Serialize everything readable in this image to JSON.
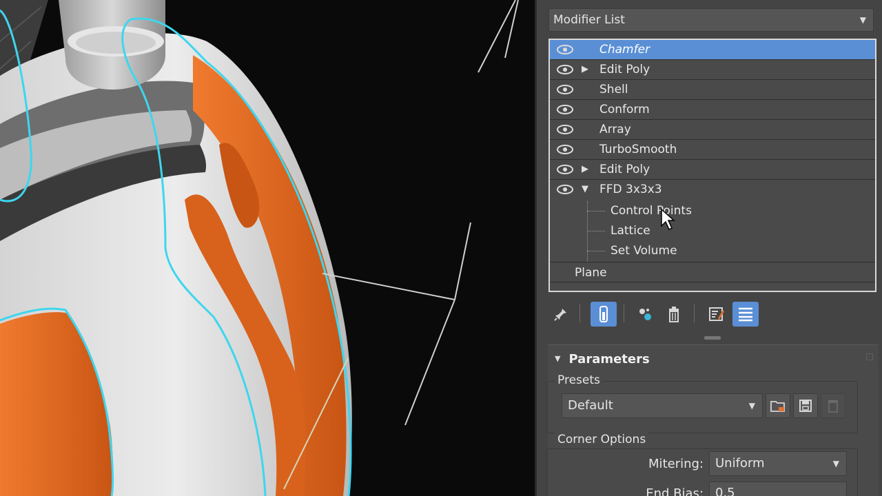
{
  "app": {
    "name": "3ds Max Modify Panel"
  },
  "modifier_list": {
    "label": "Modifier List"
  },
  "stack": {
    "items": [
      {
        "label": "Chamfer",
        "selected": true,
        "expandable": false
      },
      {
        "label": "Edit Poly",
        "selected": false,
        "expandable": true,
        "expanded": false
      },
      {
        "label": "Shell",
        "selected": false,
        "expandable": false
      },
      {
        "label": "Conform",
        "selected": false,
        "expandable": false
      },
      {
        "label": "Array",
        "selected": false,
        "expandable": false
      },
      {
        "label": "TurboSmooth",
        "selected": false,
        "expandable": false
      },
      {
        "label": "Edit Poly",
        "selected": false,
        "expandable": true,
        "expanded": false
      },
      {
        "label": "FFD 3x3x3",
        "selected": false,
        "expandable": true,
        "expanded": true
      }
    ],
    "sub_objects": [
      {
        "label": "Control Points"
      },
      {
        "label": "Lattice"
      },
      {
        "label": "Set Volume"
      }
    ],
    "base_object": {
      "label": "Plane"
    }
  },
  "toolbar": {
    "buttons": [
      {
        "icon": "pin-stack-icon",
        "active": false
      },
      {
        "icon": "show-end-result-icon",
        "active": true
      },
      {
        "icon": "make-unique-icon",
        "active": false
      },
      {
        "icon": "remove-modifier-icon",
        "active": false
      },
      {
        "icon": "configure-modifier-sets-icon",
        "active": false
      },
      {
        "icon": "stack-list-icon",
        "active": true
      }
    ]
  },
  "parameters": {
    "title": "Parameters",
    "presets": {
      "group_label": "Presets",
      "value": "Default"
    },
    "corner_options": {
      "group_label": "Corner Options",
      "mitering_label": "Mitering:",
      "mitering_value": "Uniform",
      "end_bias_label": "End Bias:",
      "end_bias_value": "0.5"
    }
  },
  "colors": {
    "selection": "#5a8fd6",
    "panel_bg": "#444444",
    "object_orange": "#e06a22",
    "outline_cyan": "#3ed6ee"
  }
}
